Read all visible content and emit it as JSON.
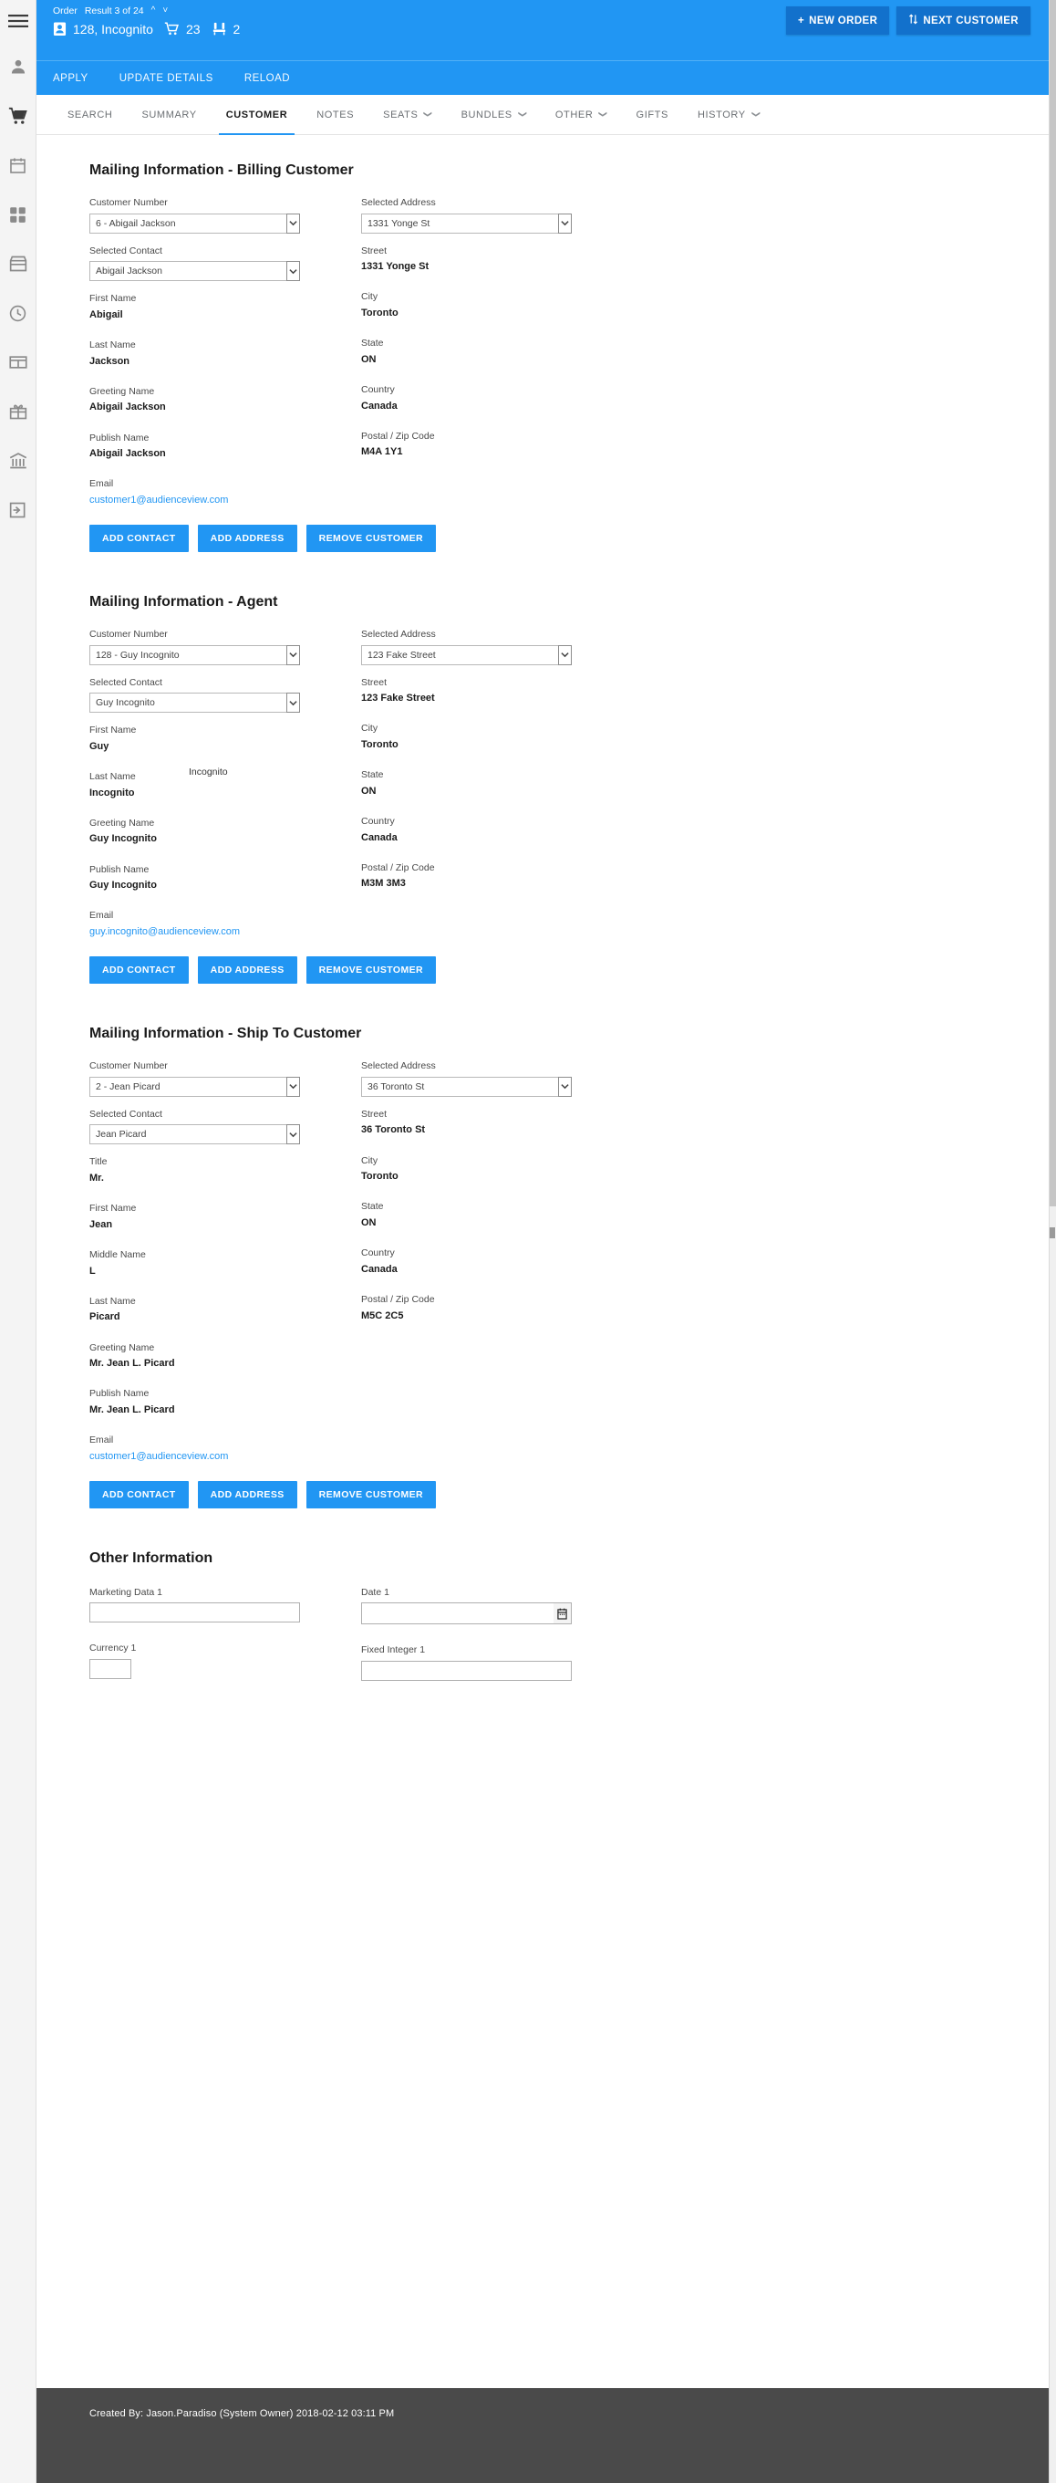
{
  "rail": {
    "items": [
      {
        "name": "hamburger-menu",
        "icon": "hamburger-icon"
      },
      {
        "name": "person",
        "icon": "person-icon"
      },
      {
        "name": "cart",
        "icon": "cart-icon"
      },
      {
        "name": "calendar",
        "icon": "calendar-icon"
      },
      {
        "name": "grid",
        "icon": "grid-icon"
      },
      {
        "name": "store",
        "icon": "store-icon"
      },
      {
        "name": "clock",
        "icon": "clock-icon"
      },
      {
        "name": "gift-card",
        "icon": "gift-card-icon"
      },
      {
        "name": "gift-box",
        "icon": "gift-box-icon"
      },
      {
        "name": "bank",
        "icon": "bank-icon"
      },
      {
        "name": "logout",
        "icon": "logout-icon"
      }
    ]
  },
  "header": {
    "entity_label": "Order",
    "result_text": "Result 3 of 24",
    "customer_text": "128, Incognito",
    "cart_count": "23",
    "seat_count": "2",
    "new_order_label": "NEW ORDER",
    "new_order_plus": "+",
    "next_customer_label": "NEXT CUSTOMER",
    "accent_color": "#2196f3",
    "button_color": "#1271cc"
  },
  "action_bar": {
    "items": [
      {
        "label": "APPLY",
        "name": "apply"
      },
      {
        "label": "UPDATE DETAILS",
        "name": "update-details"
      },
      {
        "label": "RELOAD",
        "name": "reload"
      }
    ]
  },
  "tabs": [
    {
      "label": "SEARCH",
      "has_caret": false,
      "active": false
    },
    {
      "label": "SUMMARY",
      "has_caret": false,
      "active": false
    },
    {
      "label": "CUSTOMER",
      "has_caret": false,
      "active": true
    },
    {
      "label": "NOTES",
      "has_caret": false,
      "active": false
    },
    {
      "label": "SEATS",
      "has_caret": true,
      "active": false
    },
    {
      "label": "BUNDLES",
      "has_caret": true,
      "active": false
    },
    {
      "label": "OTHER",
      "has_caret": true,
      "active": false
    },
    {
      "label": "GIFTS",
      "has_caret": false,
      "active": false
    },
    {
      "label": "HISTORY",
      "has_caret": true,
      "active": false
    }
  ],
  "sections": [
    {
      "title": "Mailing Information - Billing Customer",
      "left": [
        {
          "type": "select",
          "label": "Customer Number",
          "value": "6 - Abigail Jackson"
        },
        {
          "type": "select",
          "label": "Selected Contact",
          "value": "Abigail Jackson"
        },
        {
          "type": "text",
          "label": "First Name",
          "value": "Abigail"
        },
        {
          "type": "text",
          "label": "Last Name",
          "value": "Jackson"
        },
        {
          "type": "text",
          "label": "Greeting Name",
          "value": "Abigail Jackson"
        },
        {
          "type": "text",
          "label": "Publish Name",
          "value": "Abigail Jackson"
        },
        {
          "type": "link",
          "label": "Email",
          "value": "customer1@audienceview.com"
        }
      ],
      "right": [
        {
          "type": "select",
          "label": "Selected Address",
          "value": "1331 Yonge St"
        },
        {
          "type": "text",
          "label": "Street",
          "value": "1331 Yonge St"
        },
        {
          "type": "text",
          "label": "City",
          "value": "Toronto"
        },
        {
          "type": "text",
          "label": "State",
          "value": "ON"
        },
        {
          "type": "text",
          "label": "Country",
          "value": "Canada"
        },
        {
          "type": "text",
          "label": "Postal / Zip Code",
          "value": "M4A 1Y1"
        }
      ],
      "buttons": [
        "ADD CONTACT",
        "ADD ADDRESS",
        "REMOVE CUSTOMER"
      ]
    },
    {
      "title": "Mailing Information - Agent",
      "stray_text": "Incognito",
      "left": [
        {
          "type": "select",
          "label": "Customer Number",
          "value": "128 - Guy Incognito"
        },
        {
          "type": "select",
          "label": "Selected Contact",
          "value": "Guy Incognito"
        },
        {
          "type": "text",
          "label": "First Name",
          "value": "Guy"
        },
        {
          "type": "text",
          "label": "Last Name",
          "value": "Incognito"
        },
        {
          "type": "text",
          "label": "Greeting Name",
          "value": "Guy  Incognito"
        },
        {
          "type": "text",
          "label": "Publish Name",
          "value": "Guy  Incognito"
        },
        {
          "type": "link",
          "label": "Email",
          "value": "guy.incognito@audienceview.com"
        }
      ],
      "right": [
        {
          "type": "select",
          "label": "Selected Address",
          "value": "123 Fake Street"
        },
        {
          "type": "text",
          "label": "Street",
          "value": "123 Fake Street"
        },
        {
          "type": "text",
          "label": "City",
          "value": "Toronto"
        },
        {
          "type": "text",
          "label": "State",
          "value": "ON"
        },
        {
          "type": "text",
          "label": "Country",
          "value": "Canada"
        },
        {
          "type": "text",
          "label": "Postal / Zip Code",
          "value": "M3M 3M3"
        }
      ],
      "buttons": [
        "ADD CONTACT",
        "ADD ADDRESS",
        "REMOVE CUSTOMER"
      ]
    },
    {
      "title": "Mailing Information - Ship To Customer",
      "left": [
        {
          "type": "select",
          "label": "Customer Number",
          "value": "2 - Jean Picard"
        },
        {
          "type": "select",
          "label": "Selected Contact",
          "value": "Jean Picard"
        },
        {
          "type": "text",
          "label": "Title",
          "value": "Mr."
        },
        {
          "type": "text",
          "label": "First Name",
          "value": "Jean"
        },
        {
          "type": "text",
          "label": "Middle Name",
          "value": "L"
        },
        {
          "type": "text",
          "label": "Last Name",
          "value": "Picard"
        },
        {
          "type": "text",
          "label": "Greeting Name",
          "value": "Mr. Jean L. Picard"
        },
        {
          "type": "text",
          "label": "Publish Name",
          "value": "Mr. Jean L. Picard"
        },
        {
          "type": "link",
          "label": "Email",
          "value": "customer1@audienceview.com"
        }
      ],
      "right": [
        {
          "type": "select",
          "label": "Selected Address",
          "value": "36 Toronto St"
        },
        {
          "type": "text",
          "label": "Street",
          "value": "36 Toronto St"
        },
        {
          "type": "text",
          "label": "City",
          "value": "Toronto"
        },
        {
          "type": "text",
          "label": "State",
          "value": "ON"
        },
        {
          "type": "text",
          "label": "Country",
          "value": "Canada"
        },
        {
          "type": "text",
          "label": "Postal / Zip Code",
          "value": "M5C 2C5"
        }
      ],
      "buttons": [
        "ADD CONTACT",
        "ADD ADDRESS",
        "REMOVE CUSTOMER"
      ]
    }
  ],
  "other_information": {
    "title": "Other Information",
    "fields": [
      {
        "label": "Marketing Data 1",
        "value": "",
        "kind": "text",
        "col": "left"
      },
      {
        "label": "Date 1",
        "value": "",
        "kind": "date",
        "col": "right"
      },
      {
        "label": "Currency 1",
        "value": "",
        "kind": "currency",
        "col": "left"
      },
      {
        "label": "Fixed Integer 1",
        "value": "",
        "kind": "text",
        "col": "right"
      }
    ]
  },
  "footer": {
    "created_by_text": "Created By: Jason.Paradiso (System Owner) 2018-02-12 03:11 PM"
  }
}
